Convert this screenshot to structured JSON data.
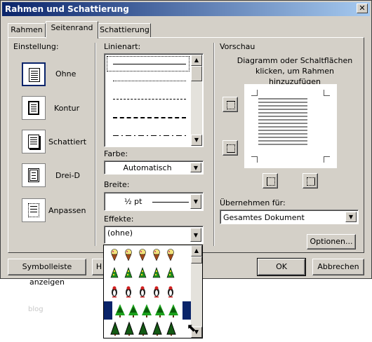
{
  "window": {
    "title": "Rahmen und Schattierung",
    "close_glyph": "✕"
  },
  "tabs": [
    {
      "label": "Rahmen",
      "active": false
    },
    {
      "label": "Seitenrand",
      "active": true
    },
    {
      "label": "Schattierung",
      "active": false
    }
  ],
  "einstellung": {
    "label": "Einstellung:",
    "options": [
      {
        "label": "Ohne",
        "icon": "none-border-icon",
        "selected": true
      },
      {
        "label": "Kontur",
        "icon": "box-border-icon",
        "selected": false
      },
      {
        "label": "Schattiert",
        "icon": "shadow-border-icon",
        "selected": false
      },
      {
        "label": "Drei-D",
        "icon": "3d-border-icon",
        "selected": false
      },
      {
        "label": "Anpassen",
        "icon": "custom-border-icon",
        "selected": false
      }
    ]
  },
  "linienart": {
    "label": "Linienart:",
    "styles": [
      "solid",
      "dotted",
      "dashed-small",
      "dashed",
      "dash-dot"
    ]
  },
  "farbe": {
    "label": "Farbe:",
    "value": "Automatisch"
  },
  "breite": {
    "label": "Breite:",
    "value": "½ pt"
  },
  "effekte": {
    "label": "Effekte:",
    "value": "(ohne)",
    "rows": [
      {
        "motif": "ice-cream-cone",
        "colors": [
          "#f2e27a",
          "#a04a1a"
        ]
      },
      {
        "motif": "party-hat",
        "colors": [
          "#1e8c1e",
          "#f0d020"
        ]
      },
      {
        "motif": "penguin",
        "colors": [
          "#1a1a1a",
          "#d02020"
        ]
      },
      {
        "motif": "pine-tree",
        "colors": [
          "#1aa01a",
          "#0a5a0a"
        ],
        "highlighted": true
      },
      {
        "motif": "dark-pine-tree",
        "colors": [
          "#145a14",
          "#000000"
        ]
      }
    ]
  },
  "vorschau": {
    "label": "Vorschau",
    "hint": "Diagramm oder Schaltflächen klicken, um Rahmen hinzuzufügen",
    "uebernehmen_label": "Übernehmen für:",
    "uebernehmen_value": "Gesamtes Dokument",
    "optionen_label": "Optionen..."
  },
  "footer": {
    "symbolleiste_label": "Symbolleiste anzeigen",
    "hidden_label": "H",
    "ok_label": "OK",
    "cancel_label": "Abbrechen"
  },
  "background_text": "blog",
  "colors": {
    "dialog_bg": "#d4d0c8",
    "title_start": "#0a246a",
    "title_end": "#a6caf0",
    "highlight": "#0a246a"
  }
}
